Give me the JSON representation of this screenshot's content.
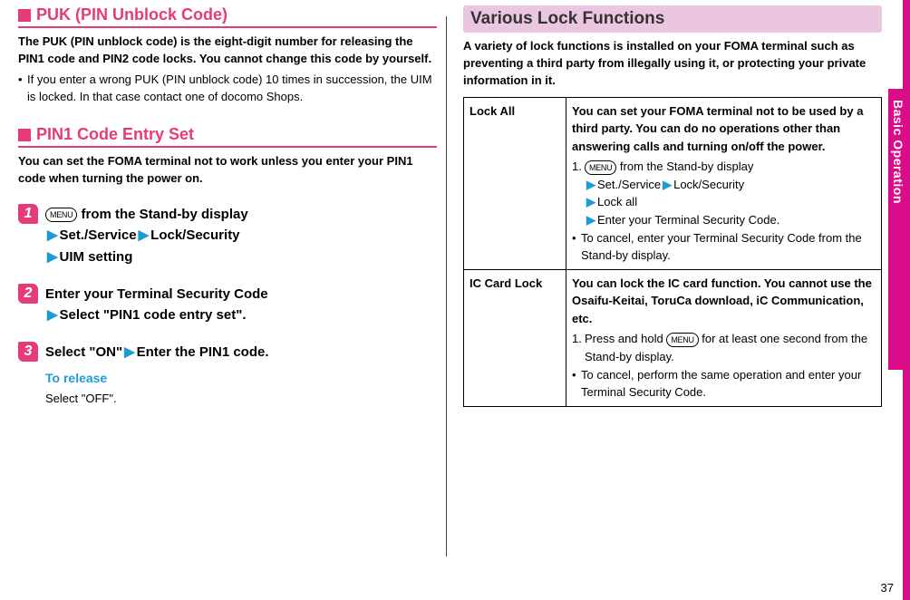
{
  "left": {
    "puk_heading": "PUK (PIN Unblock Code)",
    "puk_intro": "The PUK (PIN unblock code) is the eight-digit number for releasing the PIN1 code and PIN2 code locks. You cannot change this code by yourself.",
    "puk_bullet": "If you enter a wrong PUK (PIN unblock code) 10 times in succession, the UIM is locked. In that case contact one of docomo Shops.",
    "pin1_heading": "PIN1 Code Entry Set",
    "pin1_intro": "You can set the FOMA terminal not to work unless you enter your PIN1 code when turning the power on.",
    "menu_key": "MENU",
    "step1_a": " from the Stand-by display",
    "step1_b": "Set./Service",
    "step1_c": "Lock/Security",
    "step1_d": "UIM setting",
    "step2_a": "Enter your Terminal Security Code",
    "step2_b": "Select \"PIN1 code entry set\".",
    "step3_a": "Select \"ON\"",
    "step3_b": "Enter the PIN1 code.",
    "step3_release_lbl": "To release",
    "step3_release_txt": "Select \"OFF\"."
  },
  "right": {
    "section_title": "Various Lock Functions",
    "intro": "A variety of lock functions is installed on your FOMA terminal such as preventing a third party from illegally using it, or protecting your private information in it.",
    "table": {
      "row1_label": "Lock All",
      "row1_bold": "You can set your FOMA terminal not to be used by a third party. You can do no operations other than answering calls and turning on/off the power.",
      "row1_step_pre": " from the Stand-by display",
      "row1_step_b": "Set./Service",
      "row1_step_c": "Lock/Security",
      "row1_step_d": "Lock all",
      "row1_step_e": "Enter your Terminal Security Code.",
      "row1_cancel": "To cancel, enter your Terminal Security Code from the Stand-by display.",
      "row2_label": "IC Card Lock",
      "row2_bold": "You can lock the IC card function. You cannot use the Osaifu-Keitai, ToruCa download, iC Communication, etc.",
      "row2_step_pre": "Press and hold ",
      "row2_step_post": " for at least one second from the Stand-by display.",
      "row2_cancel": "To cancel, perform the same operation and enter your Terminal Security Code."
    }
  },
  "sidebar": {
    "label": "Basic Operation"
  },
  "page_number": "37"
}
